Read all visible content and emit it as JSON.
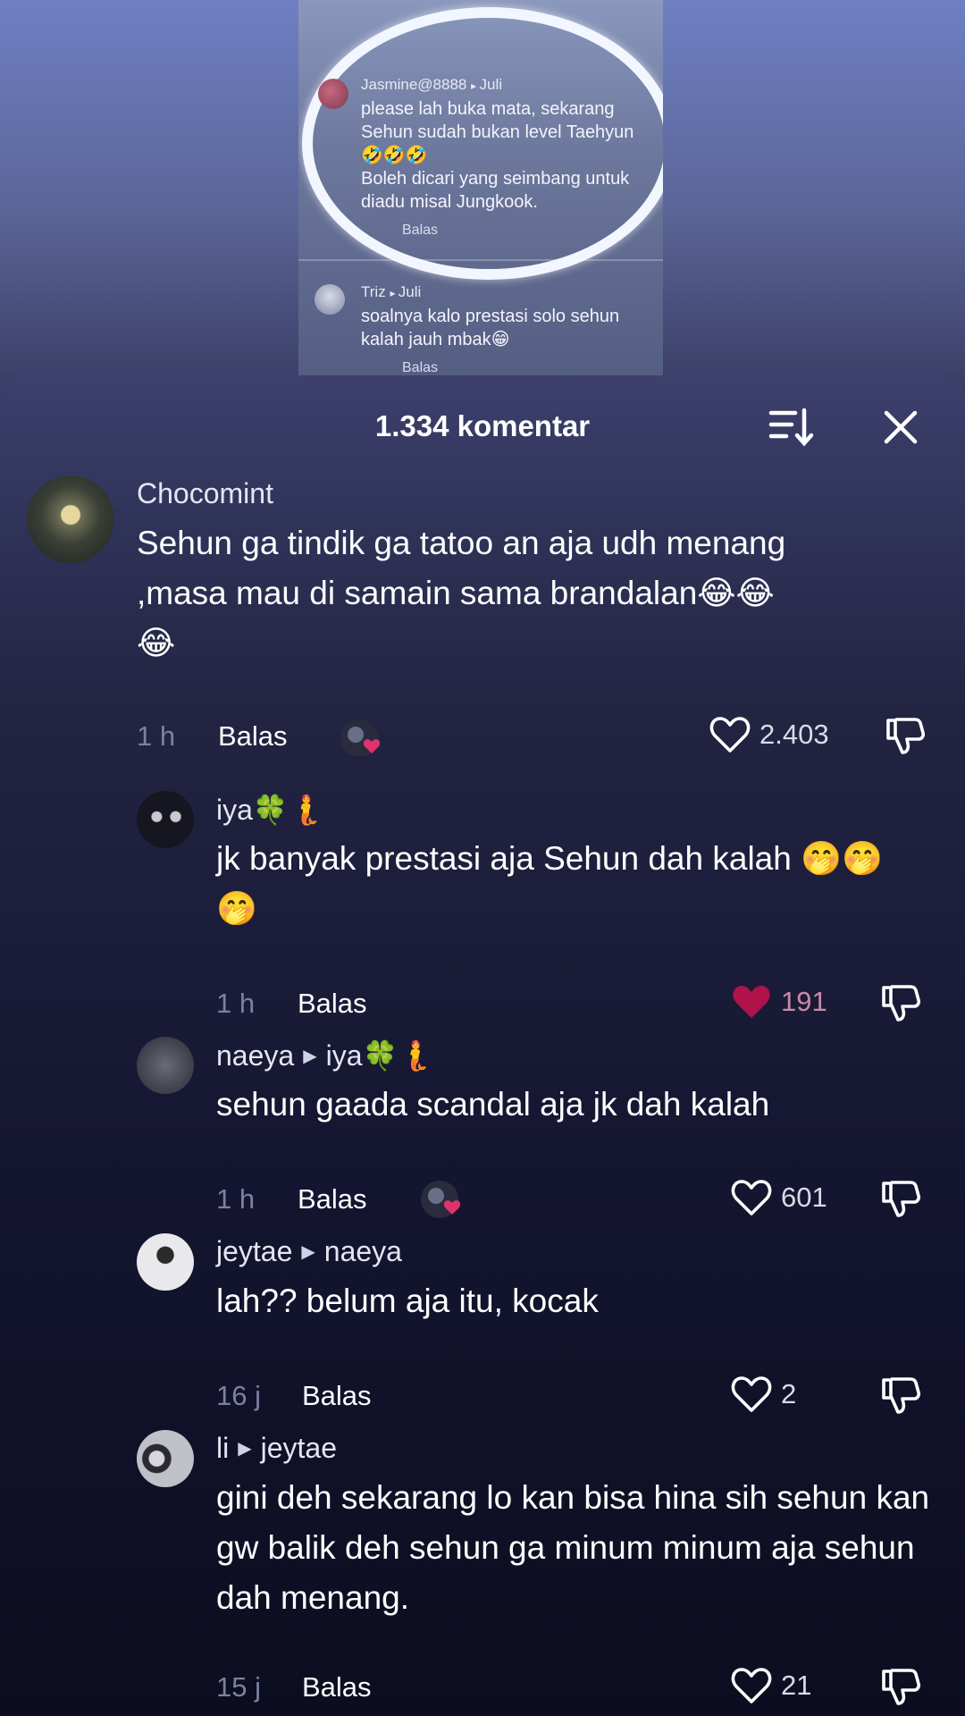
{
  "preview": {
    "comment1": {
      "username": "Jasmine@8888",
      "reply_to": "Juli",
      "lines": [
        "please lah buka mata, sekarang",
        "Sehun sudah bukan level Taehyun",
        "🤣🤣🤣",
        "Boleh dicari yang seimbang untuk",
        "diadu misal Jungkook."
      ],
      "reply_label": "Balas"
    },
    "comment2": {
      "username": "Triz",
      "reply_to": "Juli",
      "lines": [
        "soalnya kalo prestasi solo sehun",
        "kalah jauh mbak😁"
      ],
      "reply_label": "Balas"
    }
  },
  "sheet": {
    "title": "1.334 komentar"
  },
  "comments": [
    {
      "username": "Chocomint",
      "text": "Sehun ga tindik ga tatoo an aja udh menang ,masa mau di samain sama brandalan😂😂😂",
      "time": "1 h",
      "reply_label": "Balas",
      "likes": "2.403",
      "liked": false
    },
    {
      "username": "iya🍀🧜",
      "text": "jk banyak prestasi aja Sehun dah kalah 🤭🤭🤭",
      "time": "1 h",
      "reply_label": "Balas",
      "likes": "191",
      "liked": true
    },
    {
      "username": "naeya",
      "reply_to": "iya🍀🧜",
      "text": "sehun gaada scandal aja jk dah kalah",
      "time": "1 h",
      "reply_label": "Balas",
      "likes": "601",
      "liked": false
    },
    {
      "username": "jeytae",
      "reply_to": "naeya",
      "text": "lah?? belum aja itu, kocak",
      "time": "16 j",
      "reply_label": "Balas",
      "likes": "2",
      "liked": false
    },
    {
      "username": "li",
      "reply_to": "jeytae",
      "text": "gini deh sekarang lo kan bisa hina sih sehun kan gw balik deh sehun ga minum minum aja sehun dah menang.",
      "time": "15 j",
      "reply_label": "Balas",
      "likes": "21",
      "liked": false
    }
  ],
  "colors": {
    "like_active": "#b0124a",
    "liker_badge": "#e0336e"
  }
}
